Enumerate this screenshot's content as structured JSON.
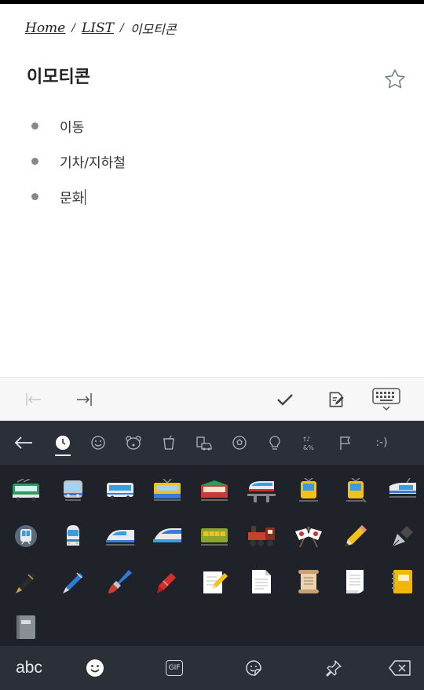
{
  "breadcrumb": {
    "home": "Home",
    "sep1": "/",
    "list": "LIST",
    "sep2": "/",
    "current": "이모티콘"
  },
  "page": {
    "title": "이모티콘"
  },
  "items": [
    "이동",
    "기차/지하철",
    "문화"
  ],
  "keyboard": {
    "categories": [
      "back-arrow",
      "recent",
      "smileys",
      "animals",
      "food",
      "travel",
      "activities",
      "objects",
      "symbols",
      "flags",
      "emoticons"
    ],
    "emoticons_label": ":-)",
    "bottom": {
      "abc": "abc",
      "gif": "GIF"
    },
    "emojis": [
      "🚎",
      "🚈",
      "🚌",
      "🚋",
      "🚃",
      "🚝",
      "🚊",
      "🚊",
      "🚝",
      "🚇",
      "🚆",
      "🚅",
      "🚄",
      "🚃",
      "🚂",
      "🎌",
      "✏️",
      "✒️",
      "🖋️",
      "🖊️",
      "🖌️",
      "🖍️",
      "📝",
      "📄",
      "📜",
      "📃",
      "📒",
      "📓"
    ]
  },
  "colors": {
    "keyboard_bg": "#1f2229",
    "keyboard_bar": "#2b2f38",
    "toolbar_bg": "#f7f7f7"
  }
}
